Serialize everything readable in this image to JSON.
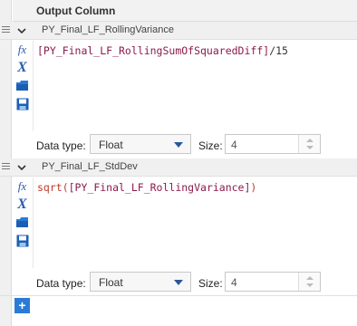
{
  "header": {
    "title": "Output Column"
  },
  "fields": [
    {
      "name": "PY_Final_LF_RollingVariance",
      "expression": {
        "ref": "[PY_Final_LF_RollingSumOfSquaredDiff]",
        "op": "/",
        "num": "15"
      },
      "data_type_label": "Data type:",
      "data_type": "Float",
      "size_label": "Size:",
      "size": "4"
    },
    {
      "name": "PY_Final_LF_StdDev",
      "expression": {
        "fn": "sqrt(",
        "ref": "[PY_Final_LF_RollingVariance]",
        "close": ")"
      },
      "data_type_label": "Data type:",
      "data_type": "Float",
      "size_label": "Size:",
      "size": "4"
    }
  ],
  "toolbar_icons": [
    "function-icon",
    "variable-icon",
    "open-folder-icon",
    "save-icon"
  ],
  "add_button": {
    "label": "+"
  },
  "colors": {
    "accent": "#2a7bd6",
    "reference": "#8b1a4a",
    "function": "#c0392b"
  }
}
